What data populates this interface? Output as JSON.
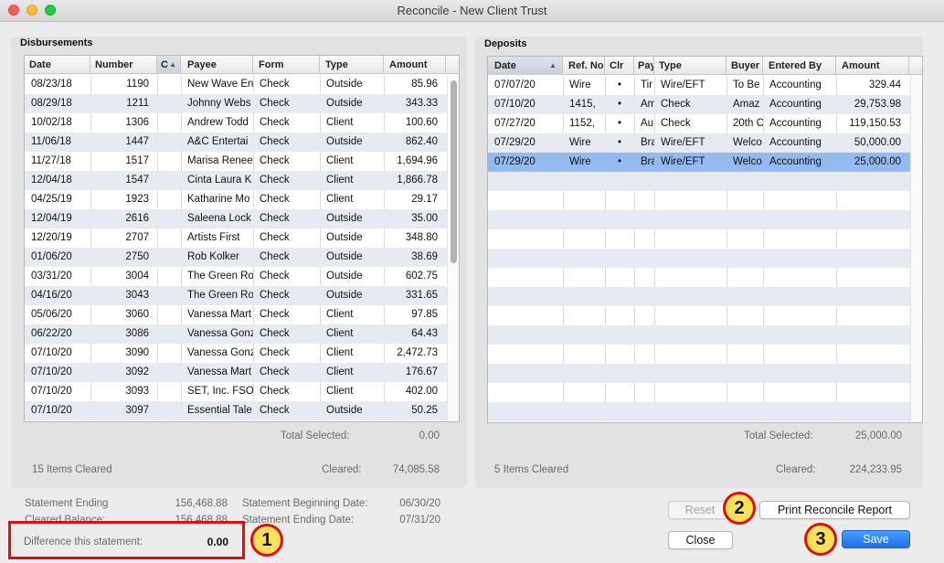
{
  "window": {
    "title": "Reconcile - New Client Trust"
  },
  "disbursements": {
    "title": "Disbursements",
    "columns": [
      "Date",
      "Number",
      "C",
      "Payee",
      "Form",
      "Type",
      "Amount"
    ],
    "rows": [
      [
        "08/23/18",
        "1190",
        "",
        "New Wave En",
        "Check",
        "Outside",
        "85.96"
      ],
      [
        "08/29/18",
        "1211",
        "",
        "Johnny Webs",
        "Check",
        "Outside",
        "343.33"
      ],
      [
        "10/02/18",
        "1306",
        "",
        "Andrew Todd",
        "Check",
        "Client",
        "100.60"
      ],
      [
        "11/06/18",
        "1447",
        "",
        "A&C Entertai",
        "Check",
        "Outside",
        "862.40"
      ],
      [
        "11/27/18",
        "1517",
        "",
        "Marisa Renee",
        "Check",
        "Client",
        "1,694.96"
      ],
      [
        "12/04/18",
        "1547",
        "",
        "Cinta Laura K",
        "Check",
        "Client",
        "1,866.78"
      ],
      [
        "04/25/19",
        "1923",
        "",
        "Katharine Mo",
        "Check",
        "Client",
        "29.17"
      ],
      [
        "12/04/19",
        "2616",
        "",
        "Saleena Lock",
        "Check",
        "Outside",
        "35.00"
      ],
      [
        "12/20/19",
        "2707",
        "",
        "Artists First",
        "Check",
        "Outside",
        "348.80"
      ],
      [
        "01/06/20",
        "2750",
        "",
        "Rob Kolker",
        "Check",
        "Outside",
        "38.69"
      ],
      [
        "03/31/20",
        "3004",
        "",
        "The Green Ro",
        "Check",
        "Outside",
        "602.75"
      ],
      [
        "04/16/20",
        "3043",
        "",
        "The Green Ro",
        "Check",
        "Outside",
        "331.65"
      ],
      [
        "05/06/20",
        "3060",
        "",
        "Vanessa Mart",
        "Check",
        "Client",
        "97.85"
      ],
      [
        "06/22/20",
        "3086",
        "",
        "Vanessa Gonz",
        "Check",
        "Client",
        "64.43"
      ],
      [
        "07/10/20",
        "3090",
        "",
        "Vanessa Gonz",
        "Check",
        "Client",
        "2,472.73"
      ],
      [
        "07/10/20",
        "3092",
        "",
        "Vanessa Mart",
        "Check",
        "Client",
        "176.67"
      ],
      [
        "07/10/20",
        "3093",
        "",
        "SET, Inc. FSO",
        "Check",
        "Client",
        "402.00"
      ],
      [
        "07/10/20",
        "3097",
        "",
        "Essential Tale",
        "Check",
        "Outside",
        "50.25"
      ]
    ],
    "total_selected_label": "Total Selected:",
    "total_selected_value": "0.00",
    "items_cleared": "15 Items Cleared",
    "cleared_label": "Cleared:",
    "cleared_value": "74,085.58"
  },
  "deposits": {
    "title": "Deposits",
    "columns": [
      "Date",
      "Ref. No",
      "Clr",
      "Pay",
      "Type",
      "Buyer",
      "Entered By",
      "Amount"
    ],
    "rows": [
      [
        "07/07/20",
        "Wire",
        "•",
        "Tir",
        "Wire/EFT",
        "To Be",
        "Accounting",
        "329.44"
      ],
      [
        "07/10/20",
        "1415,",
        "•",
        "Am",
        "Check",
        "Amaz",
        "Accounting",
        "29,753.98"
      ],
      [
        "07/27/20",
        "1152,",
        "•",
        "Au",
        "Check",
        "20th C",
        "Accounting",
        "119,150.53"
      ],
      [
        "07/29/20",
        "Wire",
        "•",
        "Bra",
        "Wire/EFT",
        "Welco",
        "Accounting",
        "50,000.00"
      ],
      [
        "07/29/20",
        "Wire",
        "•",
        "Bra",
        "Wire/EFT",
        "Welco",
        "Accounting",
        "25,000.00"
      ]
    ],
    "selected_row": 4,
    "total_selected_label": "Total Selected:",
    "total_selected_value": "25,000.00",
    "items_cleared": "5 Items Cleared",
    "cleared_label": "Cleared:",
    "cleared_value": "224,233.95"
  },
  "summary": {
    "statement_ending_label": "Statement Ending",
    "statement_ending_value": "156,468.88",
    "cleared_balance_label": "Cleared Balance:",
    "cleared_balance_value": "156,468.88",
    "beginning_date_label": "Statement Beginning Date:",
    "beginning_date_value": "06/30/20",
    "ending_date_label": "Statement Ending Date:",
    "ending_date_value": "07/31/20",
    "difference_label": "Difference this statement:",
    "difference_value": "0.00"
  },
  "buttons": {
    "reset": "Reset",
    "print": "Print Reconcile Report",
    "close": "Close",
    "save": "Save"
  },
  "callouts": [
    "1",
    "2",
    "3"
  ],
  "colors": {
    "highlight": "#e20d0d",
    "callout_fill": "#fbe15a",
    "selection": "#94bbf0",
    "accent": "#1d6fe8"
  }
}
